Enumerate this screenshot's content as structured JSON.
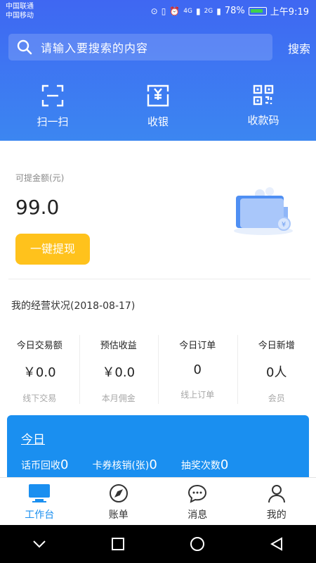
{
  "status_bar": {
    "carrier_1": "中国联通",
    "carrier_2": "中国移动",
    "network_1": "4G",
    "network_2": "2G",
    "battery": "78%",
    "time": "上午9:19"
  },
  "search": {
    "placeholder": "请输入要搜索的内容",
    "button": "搜索"
  },
  "quick_actions": [
    {
      "label": "扫一扫",
      "icon": "scan-icon"
    },
    {
      "label": "收银",
      "icon": "cashier-icon"
    },
    {
      "label": "收款码",
      "icon": "qr-code-icon"
    }
  ],
  "balance": {
    "label": "可提金额(元)",
    "value": "99.0",
    "withdraw_button": "一键提现"
  },
  "business": {
    "title": "我的经营状况(2018-08-17)",
    "stats": [
      {
        "header": "今日交易额",
        "value": "￥0.0",
        "sub": "线下交易"
      },
      {
        "header": "预估收益",
        "value": "￥0.0",
        "sub": "本月佣金"
      },
      {
        "header": "今日订单",
        "value": "0",
        "sub": "线上订单"
      },
      {
        "header": "今日新增",
        "value": "0人",
        "sub": "会员"
      }
    ]
  },
  "today": {
    "title": "今日",
    "items": [
      {
        "label": "话币回收",
        "value": "0"
      },
      {
        "label": "卡券核销(张)",
        "value": "0"
      },
      {
        "label": "抽奖次数",
        "value": "0"
      }
    ]
  },
  "tabs": [
    {
      "label": "工作台",
      "icon": "monitor-icon",
      "active": true
    },
    {
      "label": "账单",
      "icon": "compass-icon",
      "active": false
    },
    {
      "label": "消息",
      "icon": "chat-bubble-icon",
      "active": false
    },
    {
      "label": "我的",
      "icon": "person-icon",
      "active": false
    }
  ],
  "colors": {
    "header_gradient_top": "#3f67f2",
    "header_gradient_bottom": "#3c86f1",
    "accent_blue": "#1a8ff0",
    "withdraw_yellow": "#ffc21c"
  }
}
